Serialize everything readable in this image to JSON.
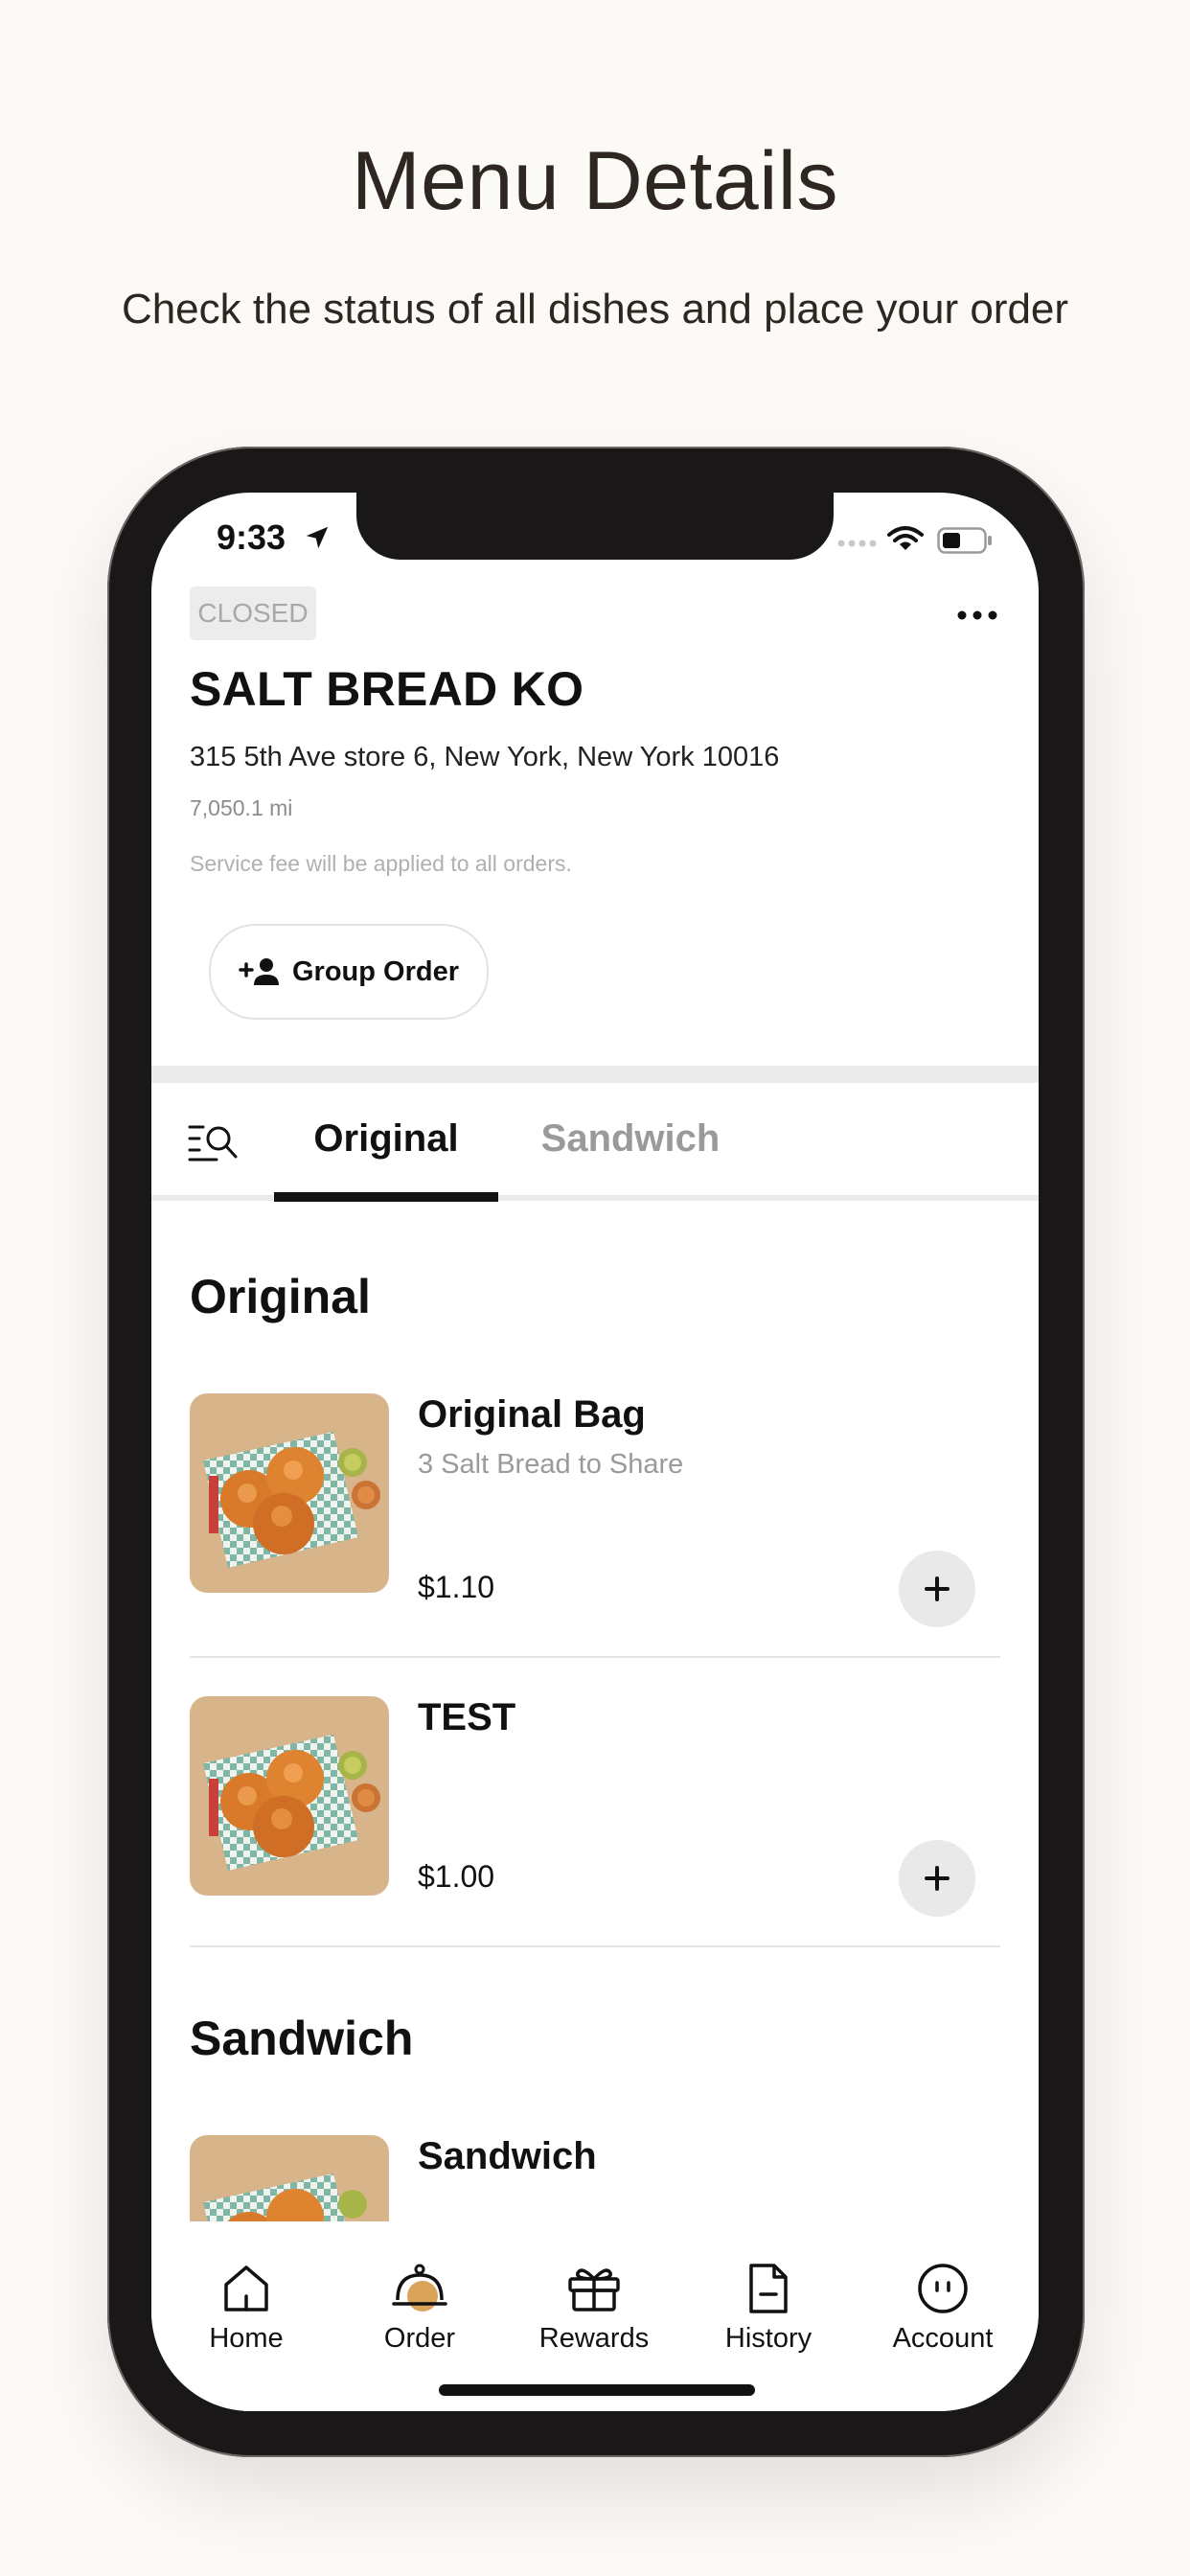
{
  "promo": {
    "title": "Menu Details",
    "subtitle": "Check the status of all dishes and place your order"
  },
  "status_bar": {
    "time": "9:33"
  },
  "store": {
    "status_badge": "CLOSED",
    "name": "SALT BREAD KO",
    "address": "315 5th Ave store 6, New York, New York 10016",
    "distance": "7,050.1 mi",
    "service_fee_note": "Service fee will be applied to all orders.",
    "group_order_label": "Group Order"
  },
  "tabs": [
    {
      "label": "Original",
      "active": true
    },
    {
      "label": "Sandwich",
      "active": false
    }
  ],
  "sections": [
    {
      "title": "Original",
      "items": [
        {
          "name": "Original Bag",
          "description": "3 Salt Bread to Share",
          "price": "$1.10"
        },
        {
          "name": "TEST",
          "description": "",
          "price": "$1.00"
        }
      ]
    },
    {
      "title": "Sandwich",
      "items": [
        {
          "name": "Sandwich",
          "description": "",
          "price": ""
        }
      ]
    }
  ],
  "bottom_nav": [
    {
      "label": "Home",
      "icon": "home-icon"
    },
    {
      "label": "Order",
      "icon": "cloche-icon"
    },
    {
      "label": "Rewards",
      "icon": "gift-icon"
    },
    {
      "label": "History",
      "icon": "document-icon"
    },
    {
      "label": "Account",
      "icon": "account-icon"
    }
  ],
  "colors": {
    "background": "#fcfaf6",
    "text": "#111111",
    "muted": "#9a9a9a",
    "accent_order": "#d9a35a"
  }
}
